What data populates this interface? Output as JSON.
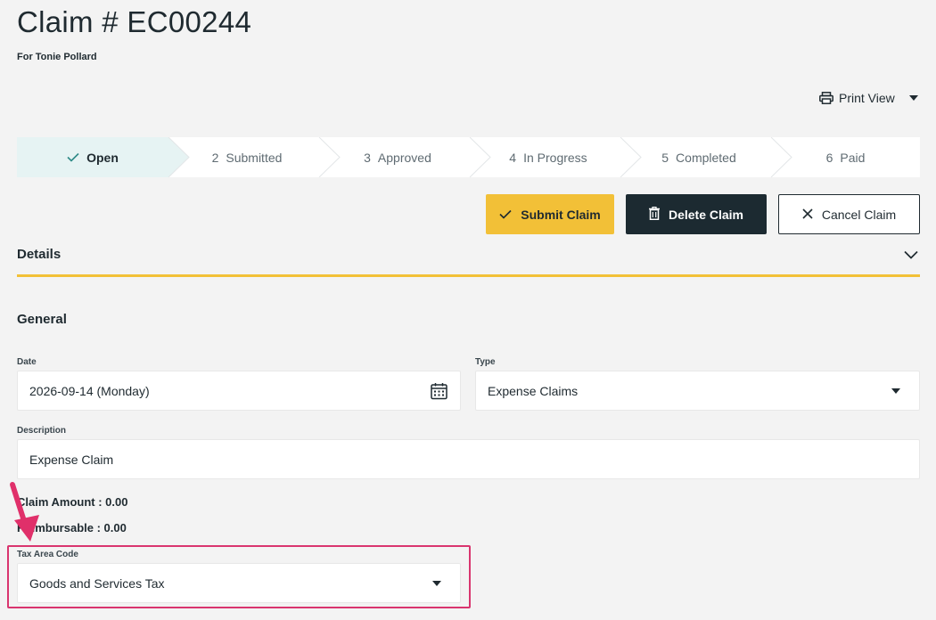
{
  "header": {
    "title": "Claim # EC00244",
    "subtitle": "For Tonie Pollard",
    "print_view_label": "Print View"
  },
  "stepper": {
    "steps": [
      {
        "num": "",
        "label": "Open",
        "active": true
      },
      {
        "num": "2",
        "label": "Submitted",
        "active": false
      },
      {
        "num": "3",
        "label": "Approved",
        "active": false
      },
      {
        "num": "4",
        "label": "In Progress",
        "active": false
      },
      {
        "num": "5",
        "label": "Completed",
        "active": false
      },
      {
        "num": "6",
        "label": "Paid",
        "active": false
      }
    ]
  },
  "actions": {
    "submit_label": "Submit Claim",
    "delete_label": "Delete Claim",
    "cancel_label": "Cancel Claim"
  },
  "details": {
    "section_label": "Details",
    "general_label": "General",
    "date_label": "Date",
    "date_value": "2026-09-14 (Monday)",
    "type_label": "Type",
    "type_value": "Expense Claims",
    "description_label": "Description",
    "description_value": "Expense Claim",
    "claim_amount_text": "Claim Amount : 0.00",
    "reimbursable_text": "Reimbursable : 0.00",
    "tax_area_label": "Tax Area Code",
    "tax_area_value": "Goods and Services Tax"
  },
  "colors": {
    "accent_yellow": "#f2c037",
    "dark_button": "#1c2a31",
    "active_step_bg": "#e6f3f3",
    "highlight_pink": "#d9356f"
  }
}
